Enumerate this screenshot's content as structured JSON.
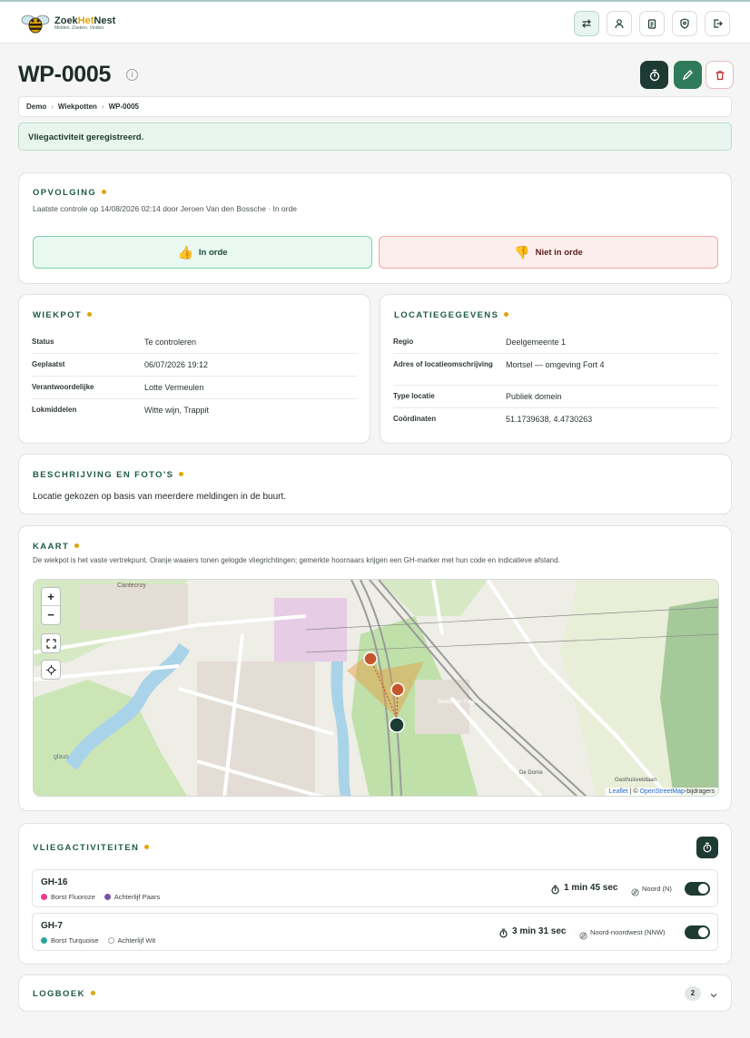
{
  "brand": {
    "name_part1": "Zoek",
    "name_part2": "Het",
    "name_part3": "Nest",
    "tagline": "Melden. Zoeken. Vinden."
  },
  "nav": [
    {
      "icon": "swap-icon"
    },
    {
      "icon": "user-icon"
    },
    {
      "icon": "clipboard-icon"
    },
    {
      "icon": "shield-icon"
    },
    {
      "icon": "logout-icon"
    }
  ],
  "page": {
    "title": "WP-0005",
    "info": "i"
  },
  "breadcrumb": {
    "items": [
      "Demo",
      "Wiekpotten",
      "WP-0005"
    ],
    "separator": "›"
  },
  "alert": {
    "message": "Vliegactiviteit geregistreerd."
  },
  "opvolging": {
    "heading": "OPVOLGING",
    "last_check": "Laatste controle op 14/08/2026 02:14 door Jeroen Van den Bossche · In orde",
    "ok_label": "In orde",
    "not_ok_label": "Niet in orde",
    "ok_emoji": "👍",
    "not_ok_emoji": "👎"
  },
  "wiekpot": {
    "heading": "WIEKPOT",
    "rows": [
      {
        "label": "Status",
        "value": "Te controleren"
      },
      {
        "label": "Geplaatst",
        "value": "06/07/2026 19:12"
      },
      {
        "label": "Verantwoordelijke",
        "value": "Lotte Vermeulen"
      },
      {
        "label": "Lokmiddelen",
        "value": "Witte wijn, Trappit"
      }
    ]
  },
  "locatie": {
    "heading": "LOCATIEGEGEVENS",
    "rows": [
      {
        "label": "Regio",
        "value": "Deelgemeente 1"
      },
      {
        "label": "Adres of locatieomschrijving",
        "value": "Mortsel — omgeving Fort 4"
      },
      {
        "label": "Type locatie",
        "value": "Publiek domein"
      },
      {
        "label": "Coördinaten",
        "value": "51.1739638, 4.4730263"
      }
    ]
  },
  "beschrijving": {
    "heading": "BESCHRIJVING EN FOTO'S",
    "text": "Locatie gekozen op basis van meerdere meldingen in de buurt."
  },
  "kaart": {
    "heading": "KAART",
    "subtitle": "De wiekpot is het vaste vertrekpunt. Oranje waaiers tonen gelogde vliegrichtingen; gemerkte hoornaars krijgen een GH-marker met hun code en indicatieve afstand.",
    "zoom_in": "+",
    "zoom_out": "−",
    "attribution_leaflet": "Leaflet",
    "attribution_sep": " | © ",
    "attribution_osm": "OpenStreetMap",
    "attribution_suffix": "-bijdragers",
    "labels": [
      "Cantecroy",
      "Bloeiende Pagen",
      "De Dorne",
      "Gasthuisveldlaan",
      "glaus"
    ]
  },
  "vlieg": {
    "heading": "VLIEGACTIVITEITEN",
    "items": [
      {
        "code": "GH-16",
        "tag1": "Borst Fluoroze",
        "tag1_color": "#e83e8c",
        "tag2": "Achterlijf Paars",
        "tag2_color": "#7b4fb0",
        "time": "1 min 45 sec",
        "direction": "Noord (N)",
        "enabled": true
      },
      {
        "code": "GH-7",
        "tag1": "Borst Turquoise",
        "tag1_color": "#2ba39b",
        "tag2": "Achterlijf Wit",
        "tag2_color": "#ffffff",
        "time": "3 min 31 sec",
        "direction": "Noord-noordwest (NNW)",
        "enabled": true
      }
    ]
  },
  "logboek": {
    "heading": "LOGBOEK",
    "count": "2"
  }
}
